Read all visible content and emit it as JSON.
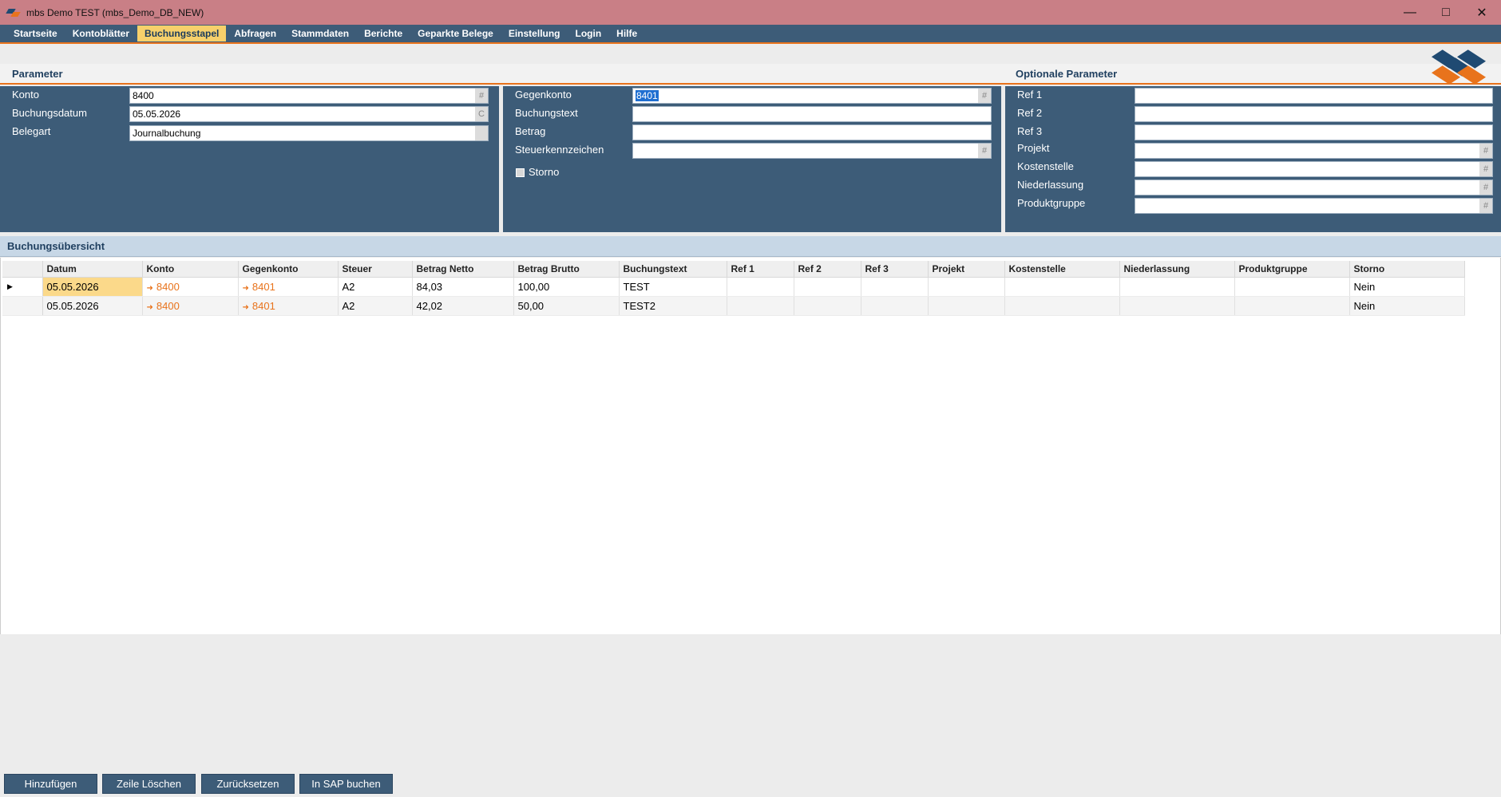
{
  "window": {
    "title": "mbs Demo TEST (mbs_Demo_DB_NEW)"
  },
  "menu": [
    "Startseite",
    "Kontoblätter",
    "Buchungsstapel",
    "Abfragen",
    "Stammdaten",
    "Berichte",
    "Geparkte Belege",
    "Einstellung",
    "Login",
    "Hilfe"
  ],
  "menu_active": "Buchungsstapel",
  "headers": {
    "parameter": "Parameter",
    "optional": "Optionale Parameter",
    "overview": "Buchungsübersicht"
  },
  "params_left": {
    "konto_label": "Konto",
    "konto_value": "8400",
    "datum_label": "Buchungsdatum",
    "datum_value": "05.05.2026",
    "belegart_label": "Belegart",
    "belegart_value": "Journalbuchung"
  },
  "params_mid": {
    "gegenkonto_label": "Gegenkonto",
    "gegenkonto_value": "8401",
    "buchungstext_label": "Buchungstext",
    "buchungstext_value": "",
    "betrag_label": "Betrag",
    "betrag_value": "",
    "steuer_label": "Steuerkennzeichen",
    "steuer_value": "",
    "storno_label": "Storno",
    "storno_checked": false
  },
  "params_right": {
    "ref1": "Ref 1",
    "ref2": "Ref 2",
    "ref3": "Ref 3",
    "projekt": "Projekt",
    "kostenstelle": "Kostenstelle",
    "niederlassung": "Niederlassung",
    "produktgruppe": "Produktgruppe"
  },
  "field_button_glyphs": {
    "hash": "#",
    "calendar": "C"
  },
  "table": {
    "columns": [
      "Datum",
      "Konto",
      "Gegenkonto",
      "Steuer",
      "Betrag Netto",
      "Betrag Brutto",
      "Buchungstext",
      "Ref 1",
      "Ref 2",
      "Ref 3",
      "Projekt",
      "Kostenstelle",
      "Niederlassung",
      "Produktgruppe",
      "Storno"
    ],
    "rows": [
      {
        "datum": "05.05.2026",
        "konto": "8400",
        "gegenkonto": "8401",
        "steuer": "A2",
        "netto": "84,03",
        "brutto": "100,00",
        "text": "TEST",
        "ref1": "",
        "ref2": "",
        "ref3": "",
        "projekt": "",
        "kostenstelle": "",
        "niederlassung": "",
        "produktgruppe": "",
        "storno": "Nein"
      },
      {
        "datum": "05.05.2026",
        "konto": "8400",
        "gegenkonto": "8401",
        "steuer": "A2",
        "netto": "42,02",
        "brutto": "50,00",
        "text": "TEST2",
        "ref1": "",
        "ref2": "",
        "ref3": "",
        "projekt": "",
        "kostenstelle": "",
        "niederlassung": "",
        "produktgruppe": "",
        "storno": "Nein"
      }
    ]
  },
  "buttons": {
    "add": "Hinzufügen",
    "delete": "Zeile Löschen",
    "reset": "Zurücksetzen",
    "post": "In SAP buchen"
  },
  "colors": {
    "accent": "#e8731c",
    "navy": "#3d5c78",
    "title": "#c97f86",
    "highlight": "#fbd98a"
  }
}
